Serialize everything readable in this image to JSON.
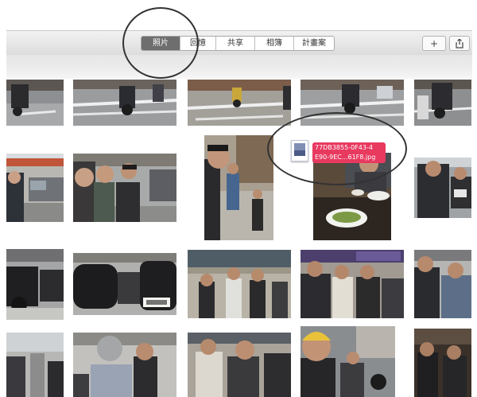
{
  "toolbar": {
    "tabs": [
      {
        "label": "照片",
        "active": true
      },
      {
        "label": "回憶",
        "active": false
      },
      {
        "label": "共享",
        "active": false
      },
      {
        "label": "相簿",
        "active": false
      },
      {
        "label": "計畫案",
        "active": false
      }
    ],
    "add_label": "+",
    "share_icon": "share-icon"
  },
  "drag": {
    "filename_line1": "77DB3855-0F43-4",
    "filename_line2": "E90-9EC...61F8.jpg"
  },
  "colors": {
    "badge": "#e8395f",
    "active_tab": "#6e6e6e"
  }
}
